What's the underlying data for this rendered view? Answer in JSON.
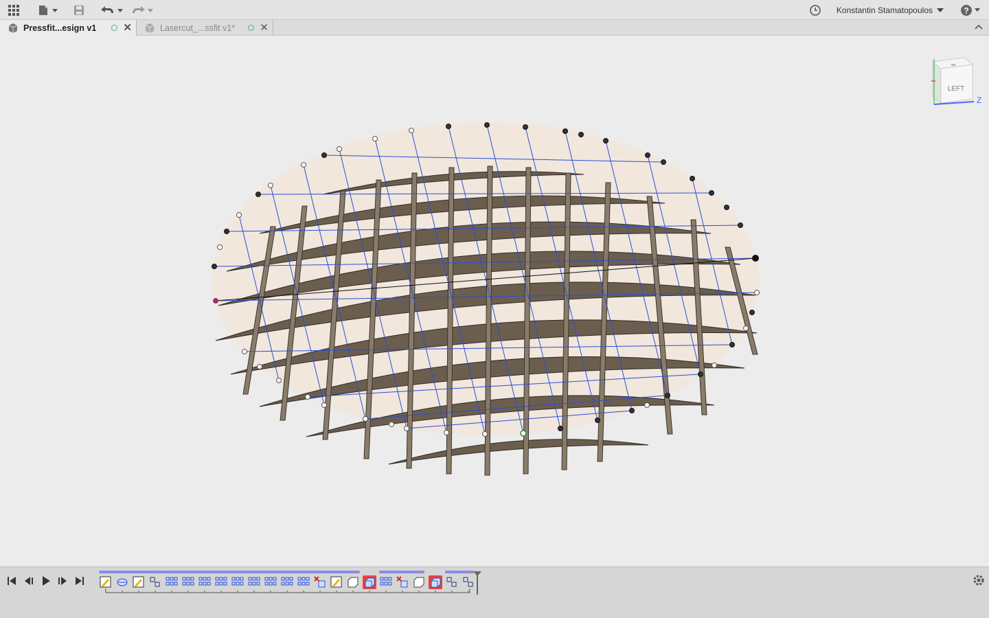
{
  "topbar": {
    "apps_icon": "grid-apps-icon",
    "file_icon": "file-menu-icon",
    "save_icon": "save-icon",
    "undo_icon": "undo-icon",
    "redo_icon": "redo-icon",
    "history_icon": "clock-icon",
    "user_name": "Konstantin Stamatopoulos",
    "help_icon": "help-icon"
  },
  "tabs": [
    {
      "label": "Pressfit...esign v1",
      "active": true
    },
    {
      "label": "Lasercut_...ssfit v1*",
      "active": false
    }
  ],
  "viewcube": {
    "face": "LEFT",
    "axis_z": "Z"
  },
  "timeline": {
    "controls": [
      "skip-to-start",
      "step-back",
      "play",
      "step-forward",
      "skip-to-end"
    ],
    "features": [
      "sketch",
      "surface",
      "sketch",
      "pattern",
      "grid",
      "grid",
      "grid",
      "grid",
      "grid",
      "grid",
      "grid",
      "grid",
      "grid",
      "delete",
      "sketch",
      "body",
      "error-body",
      "grid",
      "delete",
      "body",
      "error-body",
      "pattern",
      "pattern"
    ],
    "settings_icon": "gear-icon"
  },
  "colors": {
    "surface": "#f1e7dd",
    "rib": "#6b5e4e",
    "rib_light": "#8a7c6a",
    "wire": "#2a4fd6",
    "accent_error": "#e8413c"
  }
}
